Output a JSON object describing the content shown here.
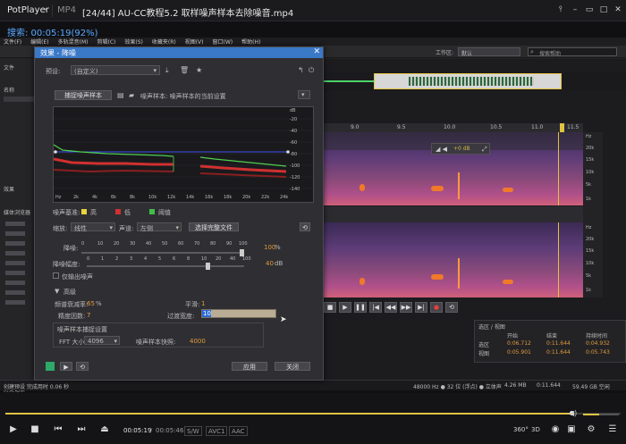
{
  "player": {
    "logo": "PotPlayer",
    "format": "MP4",
    "file_title": "[24/44] AU-CC教程5.2 取样噪声样本去除噪音.mp4",
    "search_text": "搜索: 00:05:19(92%)",
    "time_current": "00:05:19",
    "time_total": "00:05:46",
    "tags": [
      "S/W",
      "AVC1",
      "AAC"
    ],
    "progress_fraction": 0.92,
    "volume_fraction": 0.45,
    "right_labels": [
      "360°",
      "3D"
    ]
  },
  "audition": {
    "menu_items": [
      "文件(F)",
      "编辑(E)",
      "多轨混音(M)",
      "剪辑(C)",
      "效果(S)",
      "收藏夹(R)",
      "视图(V)",
      "窗口(W)",
      "帮助(H)"
    ],
    "workspace_label": "工作区:",
    "workspace_value": "默认",
    "search_placeholder": "搜索帮助",
    "panel_files": "文件",
    "panel_effects": "效果",
    "panel_history": "历史记录",
    "panel_media": "媒体浏览器",
    "panel_name": "名称",
    "status_left": "创建预设 完成用时 0.06 秒",
    "status_sample": "48000 Hz ● 32 位 (浮点) ● 立体声",
    "status_size": "4.26 MB",
    "status_dur": "0:11.644",
    "status_free": "59.49 GB 空闲",
    "ruler_ticks": [
      "9.0",
      "9.5",
      "10.0",
      "10.5",
      "11.0",
      "11.5"
    ],
    "freq_ticks": [
      "Hz",
      "20k",
      "15k",
      "10k",
      "5k",
      "1k",
      "Hz",
      "20k",
      "15k",
      "10k",
      "5k",
      "1k"
    ],
    "hud_db": "+0 dB",
    "selection": {
      "title": "选区 / 视图",
      "headers": [
        "开始",
        "结束",
        "持续时间"
      ],
      "rows": [
        {
          "label": "选区",
          "start": "0:06.712",
          "end": "0:11.644",
          "dur": "0:04.932"
        },
        {
          "label": "视图",
          "start": "0:05.901",
          "end": "0:11.644",
          "dur": "0:05.743"
        }
      ]
    }
  },
  "dialog": {
    "title": "效果 - 降噪",
    "preset_label": "预设:",
    "preset_value": "(自定义)",
    "capture_btn": "捕捉噪声样本",
    "noise_sample_text": "噪声样本: 噪声样本的当前设置",
    "graph_y_ticks": [
      "dB",
      "-20",
      "-40",
      "-60",
      "-80",
      "-100",
      "-120",
      "-140"
    ],
    "graph_x_ticks": [
      "Hz",
      "2k",
      "4k",
      "6k",
      "8k",
      "10k",
      "12k",
      "14k",
      "16k",
      "18k",
      "20k",
      "22k",
      "24k"
    ],
    "legend_label": "噪声基准:",
    "legend": [
      {
        "label": "高",
        "color": "#e8d23a"
      },
      {
        "label": "低",
        "color": "#d03030"
      },
      {
        "label": "阈值",
        "color": "#3fbf4a"
      }
    ],
    "scale_label": "缩放:",
    "scale_value": "线性",
    "channel_label": "声道:",
    "channel_value": "左侧",
    "select_all_btn": "选择完整文件",
    "reduction_label": "降噪:",
    "reduction_ticks": [
      "0",
      "10",
      "20",
      "30",
      "40",
      "50",
      "60",
      "70",
      "80",
      "90",
      "100"
    ],
    "reduction_value": "100",
    "reduction_unit": "%",
    "amount_label": "降噪幅度:",
    "amount_ticks": [
      "0",
      "1",
      "2",
      "3",
      "4",
      "5",
      "6",
      "8",
      "10",
      "20",
      "40",
      "100"
    ],
    "amount_value": "40",
    "amount_unit": "dB",
    "output_noise_only": "仅输出噪声",
    "advanced_label": "高级",
    "spectral_decay_label": "频谱衰减率:",
    "spectral_decay_value": "65",
    "spectral_decay_unit": "%",
    "smoothing_label": "平滑:",
    "smoothing_value": "1",
    "precision_label": "精度因数:",
    "precision_value": "7",
    "transition_label": "过渡宽度:",
    "transition_value": "10",
    "noise_settings_label": "噪声样本捕捉设置",
    "fft_label": "FFT 大小:",
    "fft_value": "4096",
    "snapshots_label": "噪声样本快照:",
    "snapshots_value": "4000",
    "apply_btn": "应用",
    "close_btn": "关闭"
  }
}
